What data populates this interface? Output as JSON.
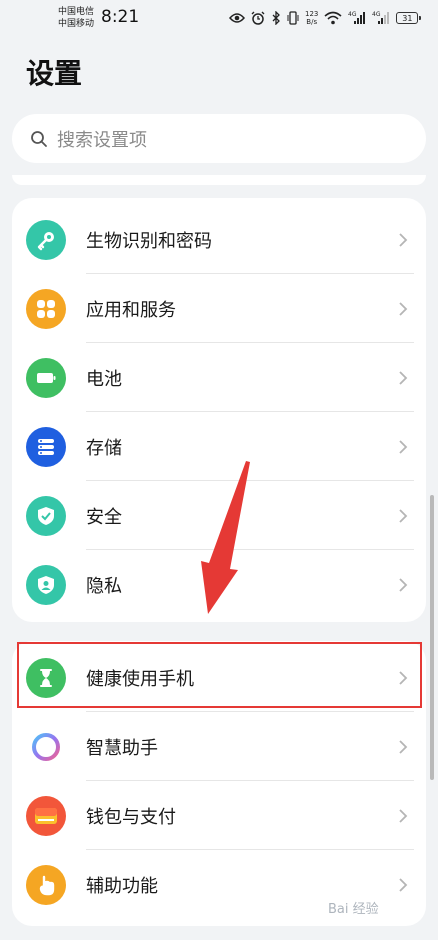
{
  "status_bar": {
    "carrier_1": "中国电信",
    "carrier_2": "中国移动",
    "time": "8:21",
    "net_speed_value": "123",
    "net_speed_unit": "B/s",
    "signal_1_label": "4G",
    "signal_2_label": "4G",
    "battery": "31"
  },
  "page": {
    "title": "设置"
  },
  "search": {
    "placeholder": "搜索设置项"
  },
  "groups": [
    {
      "items": [
        {
          "label": "生物识别和密码",
          "icon": "key-icon",
          "color": "#34c6a8"
        },
        {
          "label": "应用和服务",
          "icon": "apps-icon",
          "color": "#f5a623"
        },
        {
          "label": "电池",
          "icon": "battery-icon",
          "color": "#3fbf62"
        },
        {
          "label": "存储",
          "icon": "storage-icon",
          "color": "#1f5fe0"
        },
        {
          "label": "安全",
          "icon": "shield-check-icon",
          "color": "#34c6a8"
        },
        {
          "label": "隐私",
          "icon": "privacy-icon",
          "color": "#34c6a8"
        }
      ]
    },
    {
      "items": [
        {
          "label": "健康使用手机",
          "icon": "hourglass-icon",
          "color": "#3fbf62"
        },
        {
          "label": "智慧助手",
          "icon": "assistant-icon",
          "color": "#8a7cf0"
        },
        {
          "label": "钱包与支付",
          "icon": "wallet-icon",
          "color": "#f2563a"
        },
        {
          "label": "辅助功能",
          "icon": "accessibility-icon",
          "color": "#f5a623"
        }
      ]
    }
  ],
  "annotation": {
    "highlight_color": "#e53935"
  },
  "watermark": {
    "text": "Bai 经验"
  }
}
